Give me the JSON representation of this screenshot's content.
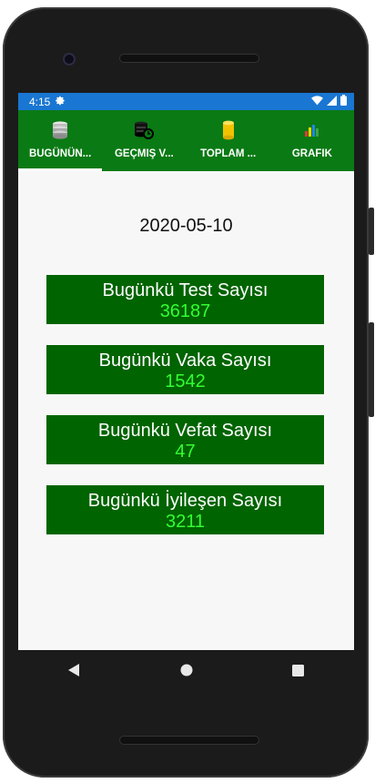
{
  "status_bar": {
    "time": "4:15",
    "settings_icon": "gear-icon",
    "wifi_icon": "wifi-icon",
    "signal_icon": "signal-icon",
    "battery_icon": "battery-icon",
    "color": "#1976d2"
  },
  "tabs": [
    {
      "label": "BUGÜNÜN...",
      "icon": "database-icon",
      "active": true
    },
    {
      "label": "GEÇMIŞ V...",
      "icon": "database-history-icon",
      "active": false
    },
    {
      "label": "TOPLAM ...",
      "icon": "cylinder-icon",
      "active": false
    },
    {
      "label": "GRAFIK",
      "icon": "bar-chart-icon",
      "active": false
    }
  ],
  "tab_color": "#0a7a14",
  "date": "2020-05-10",
  "cards": [
    {
      "title": "Bugünkü Test Sayısı",
      "value": "36187"
    },
    {
      "title": "Bugünkü Vaka Sayısı",
      "value": "1542"
    },
    {
      "title": "Bugünkü Vefat Sayısı",
      "value": "47"
    },
    {
      "title": "Bugünkü İyileşen Sayısı",
      "value": "3211"
    }
  ],
  "card_color": "#006400",
  "value_color": "#33ff33",
  "nav": {
    "back_icon": "back-triangle-icon",
    "home_icon": "home-circle-icon",
    "recents_icon": "recents-square-icon"
  }
}
